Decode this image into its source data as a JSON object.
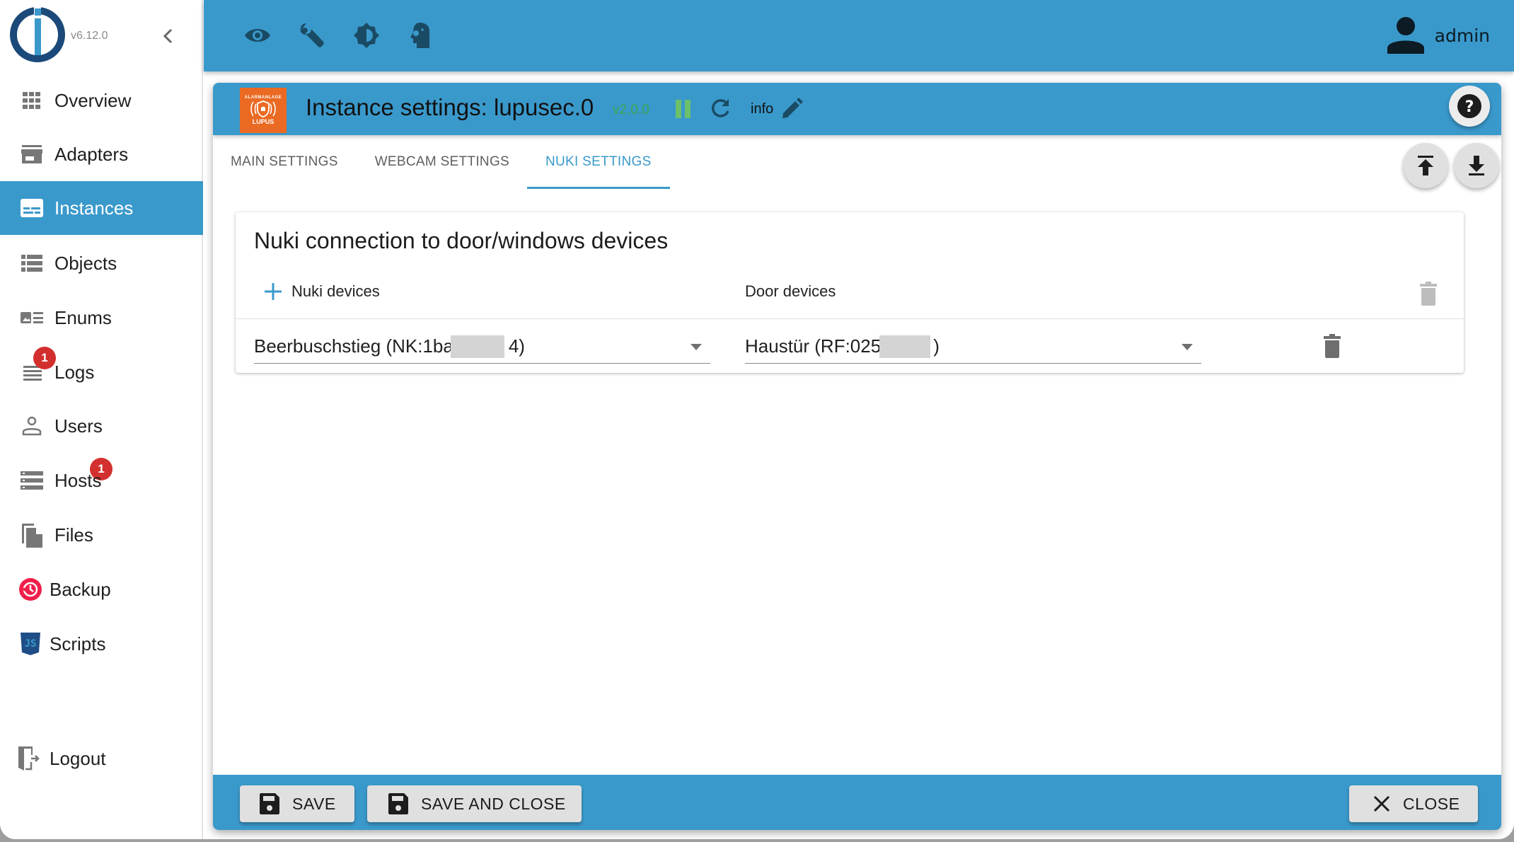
{
  "app": {
    "version": "v6.12.0",
    "user": "admin"
  },
  "sidebar": {
    "items": [
      {
        "label": "Overview",
        "icon": "grid-icon"
      },
      {
        "label": "Adapters",
        "icon": "store-icon"
      },
      {
        "label": "Instances",
        "icon": "instances-icon",
        "selected": true
      },
      {
        "label": "Objects",
        "icon": "list-icon"
      },
      {
        "label": "Enums",
        "icon": "enums-icon"
      },
      {
        "label": "Logs",
        "icon": "logs-icon",
        "badge": "1"
      },
      {
        "label": "Users",
        "icon": "user-outline-icon"
      },
      {
        "label": "Hosts",
        "icon": "hosts-icon",
        "badge": "1"
      },
      {
        "label": "Files",
        "icon": "files-icon"
      },
      {
        "label": "Backup",
        "icon": "backup-icon"
      },
      {
        "label": "Scripts",
        "icon": "javascript-icon"
      }
    ],
    "logout": "Logout"
  },
  "toolbar": {
    "icons": [
      "eye-icon",
      "wrench-icon",
      "brightness-icon",
      "expert-mode-icon"
    ]
  },
  "dialog": {
    "title": "Instance settings: lupusec.0",
    "adapter_version": "v2.0.0",
    "info_label": "info",
    "adapter_logo_top": "ALARMANLAGE",
    "adapter_logo_brand": "LUPUS",
    "tabs": [
      {
        "label": "MAIN SETTINGS",
        "active": false
      },
      {
        "label": "WEBCAM SETTINGS",
        "active": false
      },
      {
        "label": "NUKI SETTINGS",
        "active": true
      }
    ],
    "card": {
      "title": "Nuki connection to door/windows devices",
      "columns": [
        "Nuki devices",
        "Door devices"
      ],
      "rows": [
        {
          "nuki_device": "Beerbuschstieg (NK:1ba",
          "nuki_suffix": "4)",
          "door_device": "Haustür (RF:025",
          "door_suffix": ")"
        }
      ]
    },
    "footer": {
      "save": "SAVE",
      "save_close": "SAVE AND CLOSE",
      "close": "CLOSE"
    }
  },
  "colors": {
    "primary": "#3a99cb",
    "badge": "#d32f2f",
    "version_green": "#3aa64e",
    "adapter_orange": "#ea6a23"
  }
}
